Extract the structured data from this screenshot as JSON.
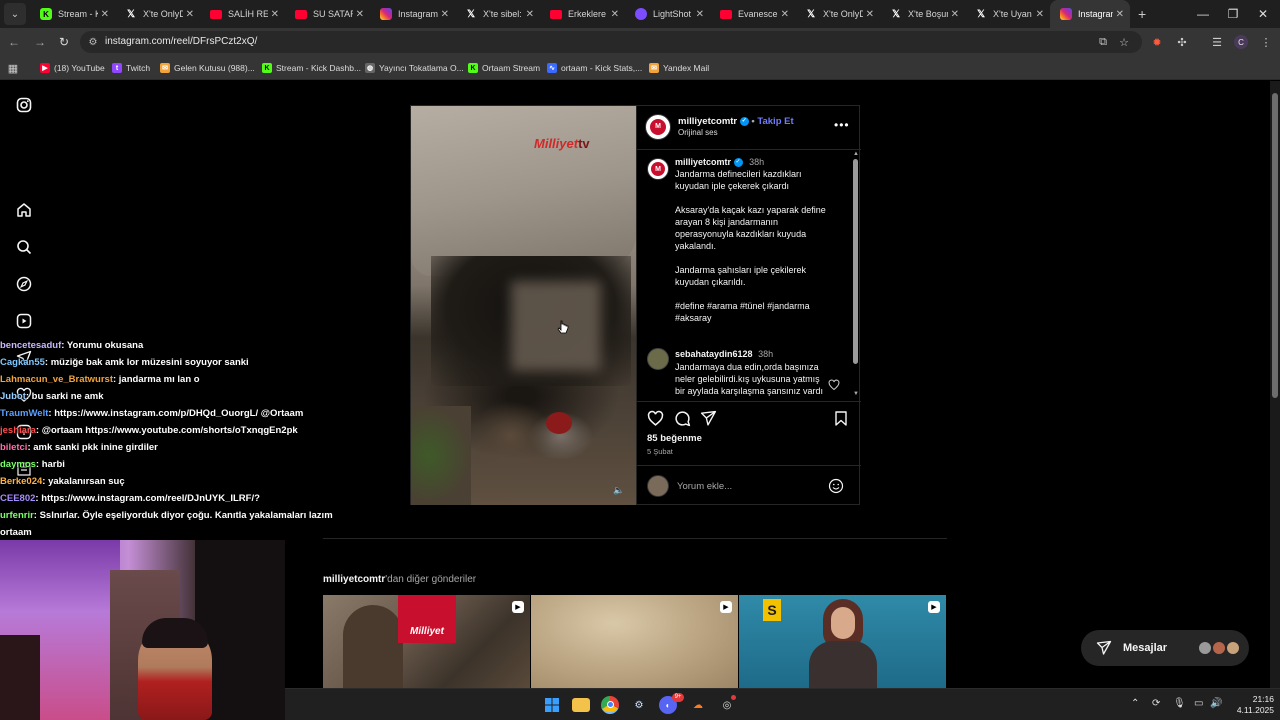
{
  "browser": {
    "tabs": [
      {
        "label": "Stream - K",
        "icon": "kick"
      },
      {
        "label": "X'te OnlyD",
        "icon": "x"
      },
      {
        "label": "SALİH REİ",
        "icon": "youtube"
      },
      {
        "label": "SU SATARA",
        "icon": "youtube"
      },
      {
        "label": "Instagram",
        "icon": "instagram"
      },
      {
        "label": "X'te sibel:",
        "icon": "x"
      },
      {
        "label": "Erkeklere",
        "icon": "youtube"
      },
      {
        "label": "LightShot",
        "icon": "lightshot"
      },
      {
        "label": "Evanescen",
        "icon": "youtube"
      },
      {
        "label": "X'te OnlyD",
        "icon": "x"
      },
      {
        "label": "X'te Boşun",
        "icon": "x"
      },
      {
        "label": "X'te Uyan",
        "icon": "x"
      },
      {
        "label": "Instagram",
        "icon": "instagram",
        "active": true
      }
    ],
    "new_tab": "+",
    "url": "instagram.com/reel/DFrsPCzt2xQ/",
    "profile_initial": "C",
    "bookmarks": [
      {
        "label": "(18) YouTube",
        "icon": "youtube"
      },
      {
        "label": "Twitch",
        "icon": "twitch"
      },
      {
        "label": "Gelen Kutusu (988)...",
        "icon": "mail"
      },
      {
        "label": "Stream - Kick Dashb...",
        "icon": "kick"
      },
      {
        "label": "Yayıncı Tokatlama O...",
        "icon": "globe"
      },
      {
        "label": "Ortaam Stream",
        "icon": "kick"
      },
      {
        "label": "ortaam - Kick Stats,...",
        "icon": "stats"
      },
      {
        "label": "Yandex Mail",
        "icon": "mail"
      }
    ]
  },
  "post": {
    "username": "milliyetcomtr",
    "follow_label": "Takip Et",
    "audio": "Orijinal ses",
    "watermark": "Milliyet",
    "watermark_tv": "tv",
    "caption_user": "milliyetcomtr",
    "caption_time": "38h",
    "caption_p1": "Jandarma definecileri kazdıkları kuyudan iple çekerek çıkardı",
    "caption_p2": "Aksaray'da kaçak kazı yaparak define arayan 8 kişi jandarmanın operasyonuyla kazdıkları kuyuda yakalandı.",
    "caption_p3": "Jandarma şahısları iple çekilerek kuyudan çıkarıldı.",
    "hashtags": "#define #arama #tünel #jandarma #aksaray",
    "comment_user": "sebahataydin6128",
    "comment_time": "38h",
    "comment_text": "Jandarmaya dua edin,orda başınıza neler gelebilirdi.kış uykusuna yatmış bir ayylada karşılaşma şansınız vardı",
    "likes": "85 beğenme",
    "date": "5 Şubat",
    "comment_placeholder": "Yorum ekle..."
  },
  "chat": [
    {
      "user": "bencetesaduf",
      "color": "#c9b8ff",
      "text": ": Yorumu okusana"
    },
    {
      "user": "Cagkan55",
      "color": "#7ec8ff",
      "text": ": müziğe bak amk lor müzesini soyuyor sanki"
    },
    {
      "user": "Lahmacun_ve_Bratwurst",
      "color": "#f2a33a",
      "text": ": jandarma mı lan o"
    },
    {
      "user": "Jubot",
      "color": "#9ad0ff",
      "text": ": bu sarki ne amk"
    },
    {
      "user": "TraumWelt",
      "color": "#5aa0ff",
      "text": ": https://www.instagram.com/p/DHQd_OuorgL/ @Ortaam"
    },
    {
      "user": "jeshiara",
      "color": "#ff4d4d",
      "text": ": @ortaam https://www.youtube.com/shorts/oTxnqgEn2pk"
    },
    {
      "user": "biletci",
      "color": "#ff6fa8",
      "text": ": amk sanki pkk inine girdiler"
    },
    {
      "user": "daymos",
      "color": "#7dff6a",
      "text": ": harbi"
    },
    {
      "user": "Berke024",
      "color": "#ffb347",
      "text": ": yakalanırsan suç"
    },
    {
      "user": "CEE802",
      "color": "#a88cff",
      "text": ": https://www.instagram.com/reel/DJnUYK_ILRF/?"
    },
    {
      "user": "urfenrir",
      "color": "#7dff6a",
      "text": ": Sslnırlar. Öyle eşeliyorduk diyor çoğu. Kanıtla yakalamaları lazım"
    },
    {
      "user": "",
      "color": "#fff",
      "text": "ortaam"
    }
  ],
  "more": {
    "username": "milliyetcomtr",
    "suffix": "'dan diğer gönderiler",
    "thumb1_logo": "Milliyet",
    "thumb3_logo": "S"
  },
  "messages": {
    "label": "Mesajlar"
  },
  "taskbar": {
    "time": "21:16",
    "date": "4.11.2025",
    "discord_badge": "9+"
  }
}
